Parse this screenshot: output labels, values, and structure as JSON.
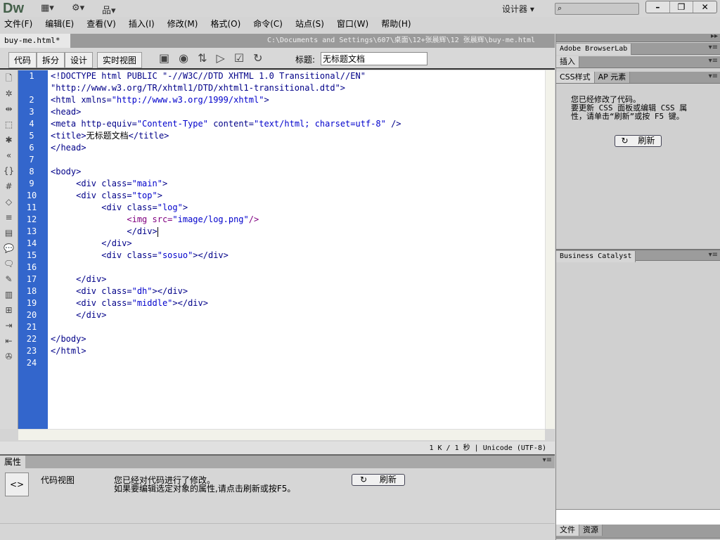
{
  "app": {
    "logo": "Dw",
    "designer": "设计器 ▾",
    "search_icon": "⌕"
  },
  "menu": [
    "文件(F)",
    "编辑(E)",
    "查看(V)",
    "插入(I)",
    "修改(M)",
    "格式(O)",
    "命令(C)",
    "站点(S)",
    "窗口(W)",
    "帮助(H)"
  ],
  "document": {
    "tab": "buy-me.html*",
    "close": "×",
    "path": "C:\\Documents and Settings\\607\\桌面\\12+张晨辉\\12 张晨辉\\buy-me.html"
  },
  "toolbar": {
    "views": [
      "代码",
      "拆分",
      "设计",
      "实时视图"
    ],
    "title_label": "标题:",
    "title_value": "无标题文档"
  },
  "code": {
    "line_numbers": [
      "1",
      "",
      "2",
      "3",
      "4",
      "5",
      "6",
      "7",
      "8",
      "9",
      "10",
      "11",
      "12",
      "13",
      "14",
      "15",
      "16",
      "17",
      "18",
      "19",
      "20",
      "21",
      "22",
      "23",
      "24"
    ],
    "lines": [
      [
        [
          "<!DOCTYPE html PUBLIC \"-//W3C//DTD XHTML 1.0 Transitional//EN\"",
          "t"
        ]
      ],
      [
        [
          "\"http://www.w3.org/TR/xhtml1/DTD/xhtml1-transitional.dtd\">",
          "t"
        ]
      ],
      [
        [
          "<html xmlns=",
          "t"
        ],
        [
          "\"http://www.w3.org/1999/xhtml\"",
          "v"
        ],
        [
          ">",
          "t"
        ]
      ],
      [
        [
          "<head>",
          "t"
        ]
      ],
      [
        [
          "<meta http-equiv=",
          "t"
        ],
        [
          "\"Content-Type\"",
          "v"
        ],
        [
          " content=",
          "t"
        ],
        [
          "\"text/html; charset=utf-8\"",
          "v"
        ],
        [
          " />",
          "t"
        ]
      ],
      [
        [
          "<title>",
          "t"
        ],
        [
          "无标题文档",
          "x"
        ],
        [
          "</title>",
          "t"
        ]
      ],
      [
        [
          "</head>",
          "t"
        ]
      ],
      [],
      [
        [
          "<body>",
          "t"
        ]
      ],
      [
        [
          "     <div class=",
          "t"
        ],
        [
          "\"main\"",
          "v"
        ],
        [
          ">",
          "t"
        ]
      ],
      [
        [
          "     <div class=",
          "t"
        ],
        [
          "\"top\"",
          "v"
        ],
        [
          ">",
          "t"
        ]
      ],
      [
        [
          "          <div class=",
          "t"
        ],
        [
          "\"log\"",
          "v"
        ],
        [
          ">",
          "t"
        ]
      ],
      [
        [
          "               <img src=",
          "p"
        ],
        [
          "\"image/log.png\"",
          "v"
        ],
        [
          "/>",
          "p"
        ]
      ],
      [
        [
          "               </div>",
          "t"
        ]
      ],
      [
        [
          "          </div>",
          "t"
        ]
      ],
      [
        [
          "          <div class=",
          "t"
        ],
        [
          "\"sosuo\"",
          "v"
        ],
        [
          "></div>",
          "t"
        ]
      ],
      [],
      [
        [
          "     </div>",
          "t"
        ]
      ],
      [
        [
          "     <div class=",
          "t"
        ],
        [
          "\"dh\"",
          "v"
        ],
        [
          "></div>",
          "t"
        ]
      ],
      [
        [
          "     <div class=",
          "t"
        ],
        [
          "\"middle\"",
          "v"
        ],
        [
          "></div>",
          "t"
        ]
      ],
      [
        [
          "     </div>",
          "t"
        ]
      ],
      [],
      [
        [
          "</body>",
          "t"
        ]
      ],
      [
        [
          "</html>",
          "t"
        ]
      ],
      []
    ]
  },
  "status": {
    "size": "1 K / 1 秒",
    "encoding": "Unicode (UTF-8)"
  },
  "properties": {
    "tab": "属性",
    "view": "代码视图",
    "msg1": "您已经对代码进行了修改。",
    "msg2": "如果要编辑选定对象的属性,请点击刷新或按F5。",
    "refresh": "刷新"
  },
  "panels": {
    "browserlab": "Adobe BrowserLab",
    "insert": "插入",
    "css": "CSS样式",
    "ap": "AP 元素",
    "css_msg1": "您已经修改了代码。",
    "css_msg2": "要更新 CSS 面板或编辑 CSS 属",
    "css_msg3": "性，请单击“刷新”或按 F5 键。",
    "refresh": "刷新",
    "bc": "Business Catalyst",
    "files": "文件",
    "assets": "资源"
  }
}
